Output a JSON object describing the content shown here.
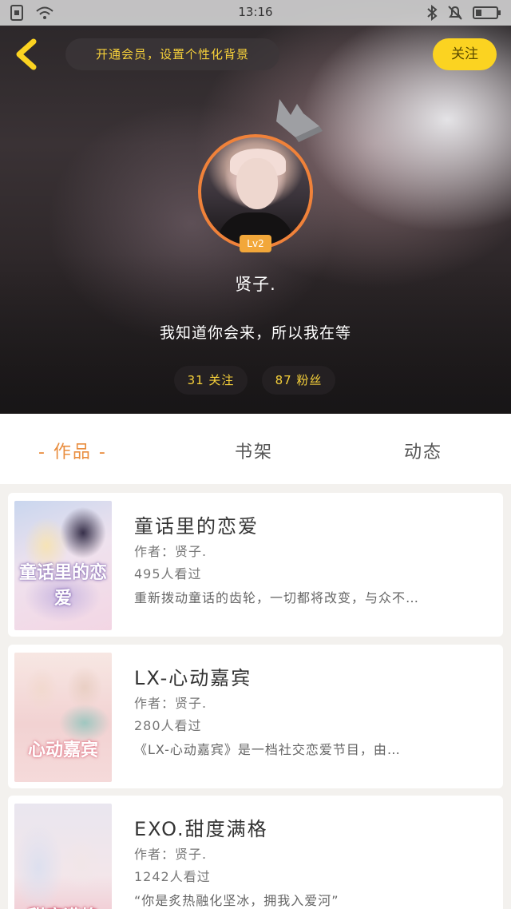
{
  "status_bar": {
    "time": "13:16"
  },
  "header": {
    "vip_banner": "开通会员，设置个性化背景",
    "follow_label": "关注"
  },
  "profile": {
    "level": "Lv2",
    "name": "贤子.",
    "bio": "我知道你会来，所以我在等",
    "following": "31 关注",
    "fans": "87 粉丝"
  },
  "tabs": [
    {
      "label": "- 作品 -",
      "active": true
    },
    {
      "label": "书架",
      "active": false
    },
    {
      "label": "动态",
      "active": false
    }
  ],
  "books": [
    {
      "title": "童话里的恋爱",
      "cover_text": "童话里的恋爱",
      "author": "作者：贤子.",
      "views": "495人看过",
      "description": "重新拨动童话的齿轮，一切都将改变，与众不…"
    },
    {
      "title": "LX-心动嘉宾",
      "cover_text": "心动嘉宾",
      "author": "作者：贤子.",
      "views": "280人看过",
      "description": "《LX-心动嘉宾》是一档社交恋爱节目，由…"
    },
    {
      "title": "EXO.甜度满格",
      "cover_text": "甜度满格",
      "author": "作者：贤子.",
      "views": "1242人看过",
      "description": "“你是炙热融化坚冰，拥我入爱河”"
    }
  ],
  "colors": {
    "accent_yellow": "#fbd321",
    "accent_orange": "#e98d3e",
    "level_badge": "#f2a73a"
  }
}
